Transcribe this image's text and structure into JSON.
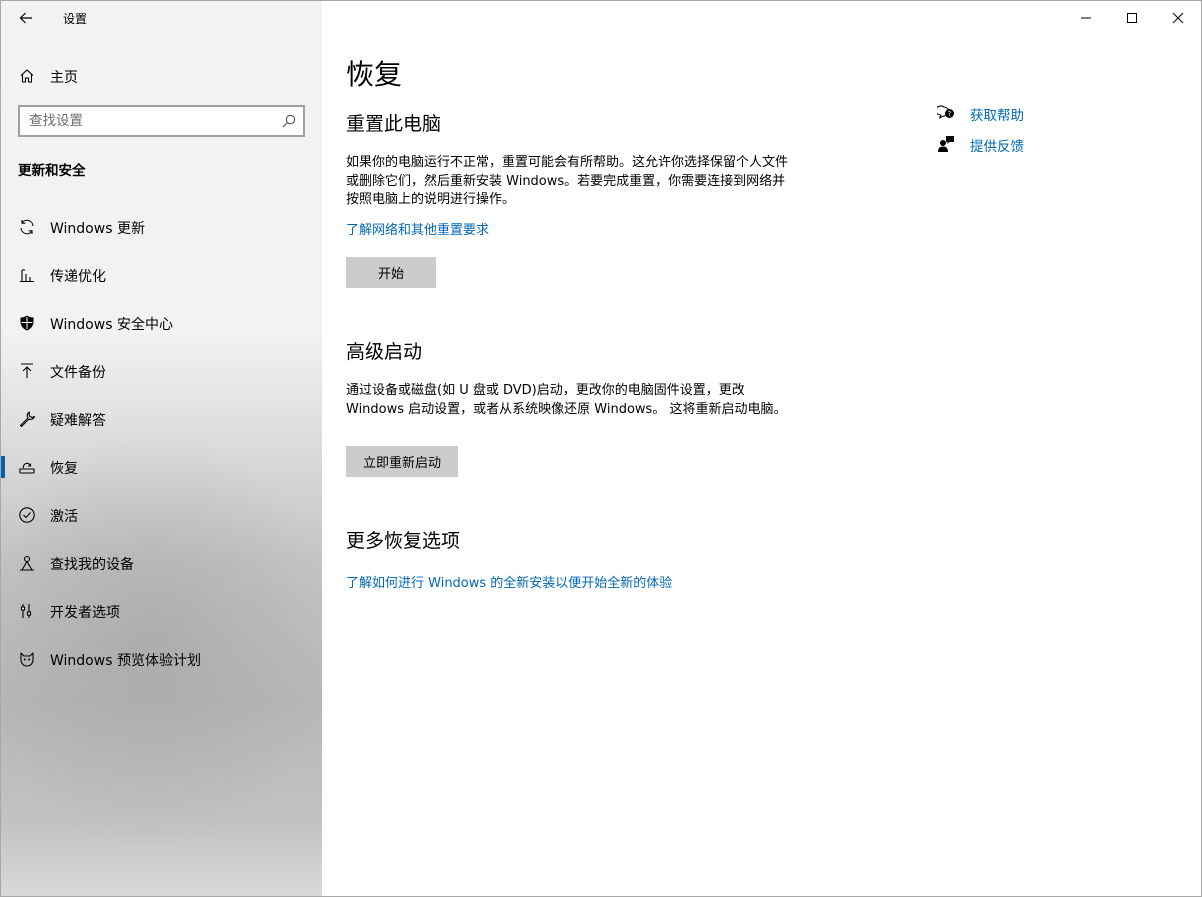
{
  "app": {
    "title": "设置"
  },
  "sidebar": {
    "home_label": "主页",
    "search_placeholder": "查找设置",
    "section_heading": "更新和安全",
    "items": [
      {
        "label": "Windows 更新",
        "icon": "sync-icon"
      },
      {
        "label": "传递优化",
        "icon": "delivery-optimization-icon"
      },
      {
        "label": "Windows 安全中心",
        "icon": "shield-icon"
      },
      {
        "label": "文件备份",
        "icon": "backup-icon"
      },
      {
        "label": "疑难解答",
        "icon": "wrench-icon"
      },
      {
        "label": "恢复",
        "icon": "recovery-icon",
        "selected": true
      },
      {
        "label": "激活",
        "icon": "activation-icon"
      },
      {
        "label": "查找我的设备",
        "icon": "find-device-icon"
      },
      {
        "label": "开发者选项",
        "icon": "developer-icon"
      },
      {
        "label": "Windows 预览体验计划",
        "icon": "insider-icon"
      }
    ]
  },
  "main": {
    "title": "恢复",
    "reset": {
      "title": "重置此电脑",
      "desc": "如果你的电脑运行不正常，重置可能会有所帮助。这允许你选择保留个人文件或删除它们，然后重新安装 Windows。若要完成重置，你需要连接到网络并按照电脑上的说明进行操作。",
      "link": "了解网络和其他重置要求",
      "button": "开始"
    },
    "advanced": {
      "title": "高级启动",
      "desc": "通过设备或磁盘(如 U 盘或 DVD)启动，更改你的电脑固件设置，更改 Windows 启动设置，或者从系统映像还原 Windows。 这将重新启动电脑。",
      "button": "立即重新启动"
    },
    "more": {
      "title": "更多恢复选项",
      "link": "了解如何进行 Windows 的全新安装以便开始全新的体验"
    }
  },
  "help": {
    "get_help": "获取帮助",
    "give_feedback": "提供反馈"
  },
  "colors": {
    "accent": "#0067b8",
    "selection_bar": "#0063b1",
    "button": "#cccccc"
  }
}
